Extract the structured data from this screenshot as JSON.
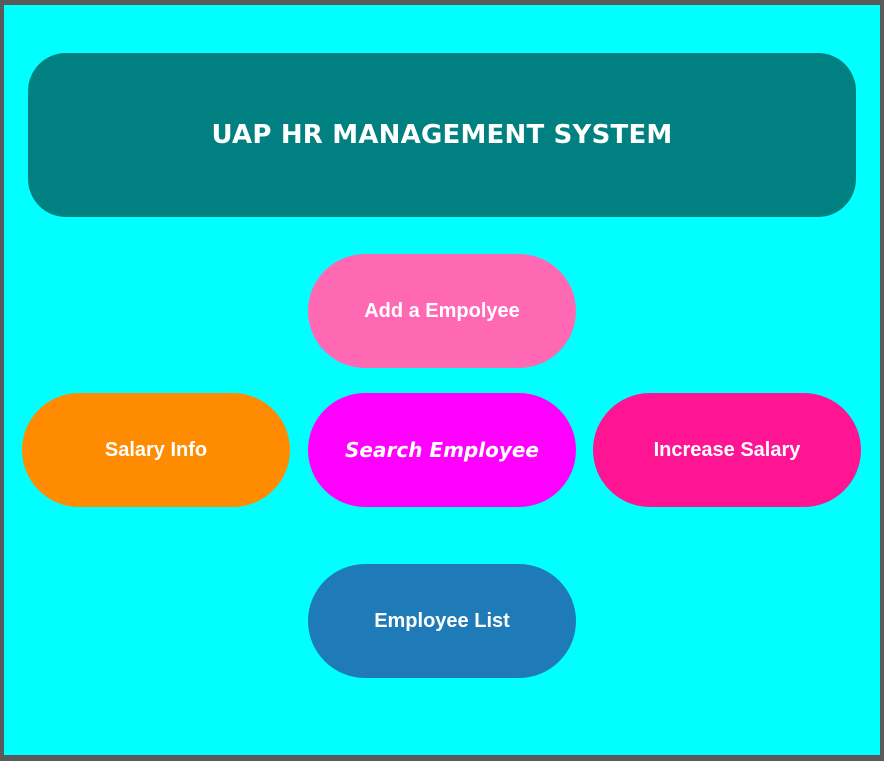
{
  "header": {
    "title": "UAP HR MANAGEMENT SYSTEM"
  },
  "buttons": {
    "add_employee": "Add a Empolyee",
    "salary_info": "Salary Info",
    "search_employee": "Search Employee",
    "increase_salary": "Increase Salary",
    "employee_list": "Employee List"
  },
  "colors": {
    "background": "#00ffff",
    "header": "#008080",
    "add_employee": "#ff69b4",
    "salary_info": "#ff8c00",
    "search_employee": "#ff00ff",
    "increase_salary": "#ff1493",
    "employee_list": "#1f7ab8"
  }
}
